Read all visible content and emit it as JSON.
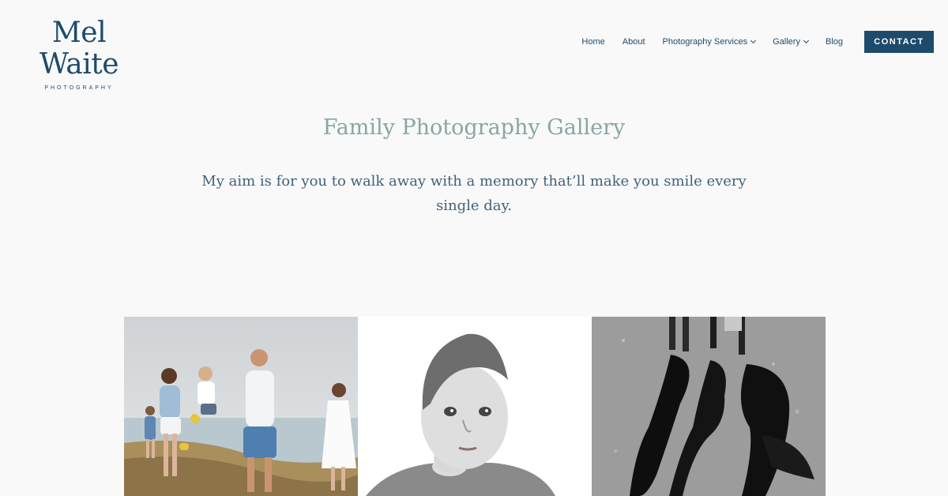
{
  "header": {
    "logo": {
      "main": "Mel Waite",
      "sub": "PHOTOGRAPHY"
    },
    "nav": [
      {
        "label": "Home",
        "has_dropdown": false
      },
      {
        "label": "About",
        "has_dropdown": false
      },
      {
        "label": "Photography Services",
        "has_dropdown": true
      },
      {
        "label": "Gallery",
        "has_dropdown": true
      },
      {
        "label": "Blog",
        "has_dropdown": false
      }
    ],
    "contact_label": "CONTACT"
  },
  "hero": {
    "title": "Family Photography Gallery",
    "intro": "My aim is for you to walk away with a memory that’ll make you smile every single day."
  },
  "gallery": {
    "photos": [
      {
        "name": "family-walking-photo",
        "style": "color"
      },
      {
        "name": "toddler-portrait-photo",
        "style": "black-and-white"
      },
      {
        "name": "beach-shadows-photo",
        "style": "black-and-white"
      }
    ]
  },
  "colors": {
    "brand": "#1e4b6b",
    "title": "#8aa5a3",
    "body_text": "#41627a",
    "background": "#f9f9fa"
  }
}
